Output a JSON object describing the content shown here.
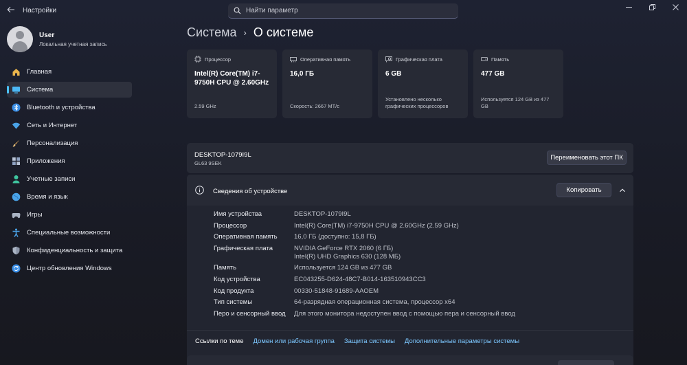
{
  "window": {
    "title": "Настройки",
    "controls": [
      "minimize",
      "maximize",
      "close"
    ]
  },
  "search": {
    "placeholder": "Найти параметр"
  },
  "profile": {
    "name": "User",
    "subtitle": "Локальная учетная запись"
  },
  "nav": {
    "items": [
      {
        "label": "Главная",
        "icon": "home-icon",
        "active": false
      },
      {
        "label": "Система",
        "icon": "system-icon",
        "active": true
      },
      {
        "label": "Bluetooth и устройства",
        "icon": "bluetooth-icon",
        "active": false
      },
      {
        "label": "Сеть и Интернет",
        "icon": "wifi-icon",
        "active": false
      },
      {
        "label": "Персонализация",
        "icon": "brush-icon",
        "active": false
      },
      {
        "label": "Приложения",
        "icon": "apps-icon",
        "active": false
      },
      {
        "label": "Учетные записи",
        "icon": "account-icon",
        "active": false
      },
      {
        "label": "Время и язык",
        "icon": "globe-icon",
        "active": false
      },
      {
        "label": "Игры",
        "icon": "gamepad-icon",
        "active": false
      },
      {
        "label": "Специальные возможности",
        "icon": "accessibility-icon",
        "active": false
      },
      {
        "label": "Конфиденциальность и защита",
        "icon": "shield-icon",
        "active": false
      },
      {
        "label": "Центр обновления Windows",
        "icon": "update-icon",
        "active": false
      }
    ]
  },
  "breadcrumb": {
    "parent": "Система",
    "separator": "›",
    "current": "О системе"
  },
  "cards": [
    {
      "title": "Процессор",
      "value": "Intel(R) Core(TM) i7-9750H CPU @ 2.60GHz",
      "foot": "2.59 GHz",
      "icon": "cpu-icon"
    },
    {
      "title": "Оперативная память",
      "value": "16,0 ГБ",
      "foot": "Скорость: 2667 МТ/с",
      "icon": "ram-icon"
    },
    {
      "title": "Графическая плата",
      "value": "6 GB",
      "foot": "Установлено несколько графических процессоров",
      "icon": "gpu-icon"
    },
    {
      "title": "Память",
      "value": "477 GB",
      "foot": "Используется 124 GB из 477 GB",
      "icon": "storage-icon"
    }
  ],
  "pc": {
    "name": "DESKTOP-1079I9L",
    "model": "GL63 9SEK",
    "rename_label": "Переименовать этот ПК"
  },
  "device": {
    "title": "Сведения об устройстве",
    "copy_label": "Копировать",
    "specs": [
      {
        "label": "Имя устройства",
        "value": "DESKTOP-1079I9L"
      },
      {
        "label": "Процессор",
        "value": "Intel(R) Core(TM) i7-9750H CPU @ 2.60GHz (2.59 GHz)"
      },
      {
        "label": "Оперативная память",
        "value": "16,0 ГБ (доступно: 15,8 ГБ)"
      },
      {
        "label": "Графическая плата",
        "value": "NVIDIA GeForce RTX 2060 (6 ГБ)",
        "value2": "Intel(R) UHD Graphics 630 (128 МБ)"
      },
      {
        "label": "Память",
        "value": "Используется 124 GB из 477 GB"
      },
      {
        "label": "Код устройства",
        "value": "EC043255-D624-48C7-B014-163510943CC3"
      },
      {
        "label": "Код продукта",
        "value": "00330-51848-91689-AAOEM"
      },
      {
        "label": "Тип системы",
        "value": "64-разрядная операционная система, процессор x64"
      },
      {
        "label": "Перо и сенсорный ввод",
        "value": "Для этого монитора недоступен ввод с помощью пера и сенсорный ввод"
      }
    ]
  },
  "related": {
    "label": "Ссылки по теме",
    "links": [
      "Домен или рабочая группа",
      "Защита системы",
      "Дополнительные параметры системы"
    ]
  },
  "colors": {
    "accent": "#4cc2ff",
    "link": "#7cc7ff",
    "card": "#272a35"
  }
}
